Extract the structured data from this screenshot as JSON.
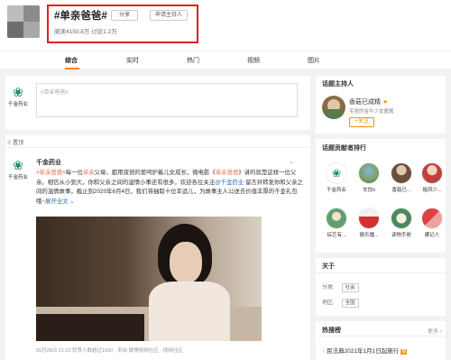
{
  "header": {
    "title": "#单亲爸爸#",
    "stats": "阅读4150.8万  讨论1.2万",
    "share_label": "分享",
    "apply_host_label": "申请主持人"
  },
  "tabs": [
    {
      "label": "综合"
    },
    {
      "label": "实时"
    },
    {
      "label": "热门"
    },
    {
      "label": "视频"
    },
    {
      "label": "图片"
    }
  ],
  "composer": {
    "brand": "千金药业",
    "placeholder": "#单亲爸爸#"
  },
  "post": {
    "pin_label": "置顶",
    "author": "千金药业",
    "body_tag": "#单亲爸爸#",
    "body_1": "每一位",
    "body_kw1": "单亲",
    "body_2": "父母，都用双倍的爱呵护着儿女成长，微电影《",
    "body_kw2": "单亲爸爸",
    "body_3": "》讲的就是这样一位父亲。相信从小到大，你和父亲之间的温情小事还有很多，欢迎各位关注",
    "body_at": "@千金药业",
    "body_4": " 留言并转发你和父亲之间的温情故事，截止到2020年6月4日，我们将抽取十位幸运儿，为故事主人公送去价值丰厚的千金礼包哦~",
    "expand": "展开全文",
    "meta": "05月28日 21:23 转赞人数超过1600 · 来自 微博视频社区 · 视频社区"
  },
  "sidebar": {
    "host_title": "话题主持人",
    "host_name": "香菇已成精",
    "host_desc": "宅居的金牛少女酱酱",
    "follow_label": "+关注",
    "contrib_title": "话题贡献者排行",
    "contributors": [
      {
        "name": "千金药业"
      },
      {
        "name": "车饮ti"
      },
      {
        "name": "香菇已..."
      },
      {
        "name": "姐凤少..."
      },
      {
        "name": "综艺有..."
      },
      {
        "name": "娱乐播..."
      },
      {
        "name": "读物手册"
      },
      {
        "name": "娜记人"
      }
    ],
    "about_title": "关于",
    "cat_label": "分类:",
    "cat_value": "社会",
    "region_label": "地区:",
    "region_value": "全国",
    "hot_title": "热搜榜",
    "hot_more": "更多",
    "hot_item": "民法典2021年1月1日起施行"
  },
  "colors": {
    "accent": "#ff8200",
    "highlight_border": "#e02020",
    "link": "#eb7350"
  }
}
